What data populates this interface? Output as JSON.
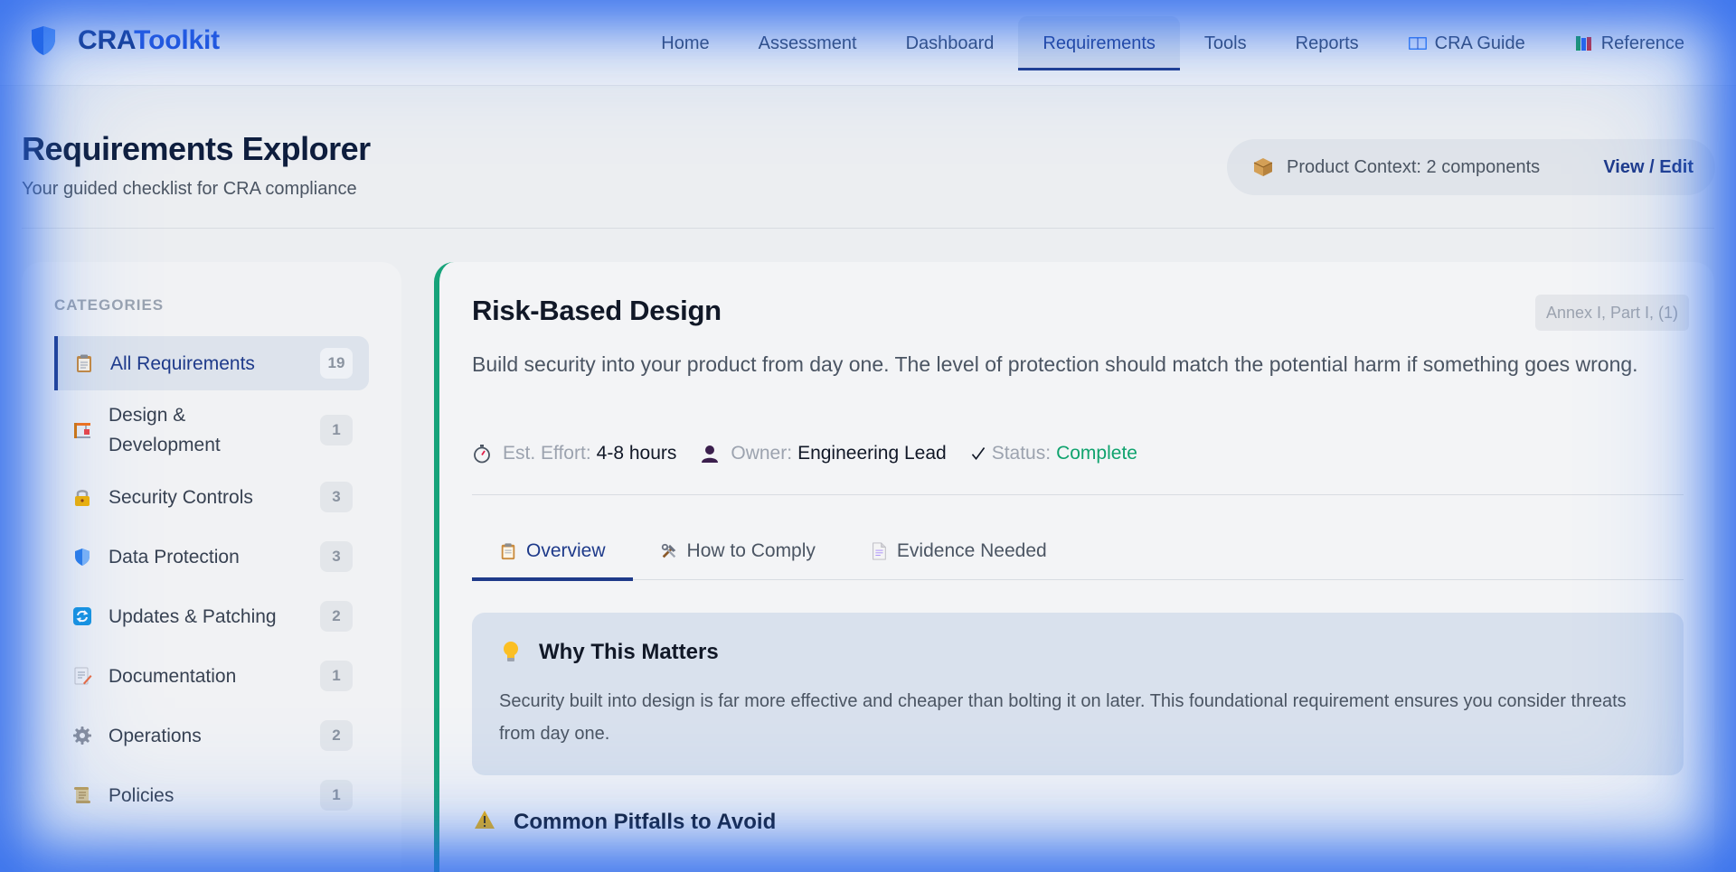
{
  "brand": {
    "prefix": "CRA",
    "suffix": "Toolkit",
    "color": "#1e3a8a"
  },
  "nav": {
    "items": [
      {
        "label": "Home",
        "icon": ""
      },
      {
        "label": "Assessment",
        "icon": ""
      },
      {
        "label": "Dashboard",
        "icon": ""
      },
      {
        "label": "Requirements",
        "icon": "",
        "active": true
      },
      {
        "label": "Tools",
        "icon": ""
      },
      {
        "label": "Reports",
        "icon": ""
      },
      {
        "label": "CRA Guide",
        "icon": "open-book-icon"
      },
      {
        "label": "Reference",
        "icon": "books-icon"
      }
    ]
  },
  "page": {
    "title": "Requirements Explorer",
    "subtitle": "Your guided checklist for CRA compliance"
  },
  "context": {
    "icon": "package-icon",
    "label": "Product Context: 2 components",
    "link": "View / Edit"
  },
  "sidebar": {
    "heading": "CATEGORIES",
    "items": [
      {
        "label": "All Requirements",
        "count": "19",
        "icon": "clipboard-icon",
        "active": true
      },
      {
        "label": "Design & Development",
        "count": "1",
        "icon": "construction-icon"
      },
      {
        "label": "Security Controls",
        "count": "3",
        "icon": "lock-icon"
      },
      {
        "label": "Data Protection",
        "count": "3",
        "icon": "shield-icon"
      },
      {
        "label": "Updates & Patching",
        "count": "2",
        "icon": "refresh-icon"
      },
      {
        "label": "Documentation",
        "count": "1",
        "icon": "memo-icon"
      },
      {
        "label": "Operations",
        "count": "2",
        "icon": "gear-icon"
      },
      {
        "label": "Policies",
        "count": "1",
        "icon": "scroll-icon"
      }
    ]
  },
  "requirement": {
    "title": "Risk-Based Design",
    "annex": "Annex I, Part I, (1)",
    "description": "Build security into your product from day one. The level of protection should match the potential harm if something goes wrong.",
    "meta": {
      "effort_label": "Est. Effort:",
      "effort_value": "4-8 hours",
      "owner_label": "Owner:",
      "owner_value": "Engineering Lead",
      "status_label": "Status:",
      "status_value": "Complete"
    },
    "tabs": [
      {
        "label": "Overview",
        "icon": "clipboard-icon",
        "active": true
      },
      {
        "label": "How to Comply",
        "icon": "tools-icon"
      },
      {
        "label": "Evidence Needed",
        "icon": "document-icon"
      }
    ],
    "why": {
      "icon": "lightbulb-icon",
      "title": "Why This Matters",
      "text": "Security built into design is far more effective and cheaper than bolting it on later. This foundational requirement ensures you consider threats from day one."
    },
    "pitfalls": {
      "icon": "warning-icon",
      "title": "Common Pitfalls to Avoid"
    }
  },
  "colors": {
    "accent": "#1e3a8a",
    "status_complete": "#10a36e",
    "card_border": "#16a37a",
    "vignette": "#2563eb"
  }
}
